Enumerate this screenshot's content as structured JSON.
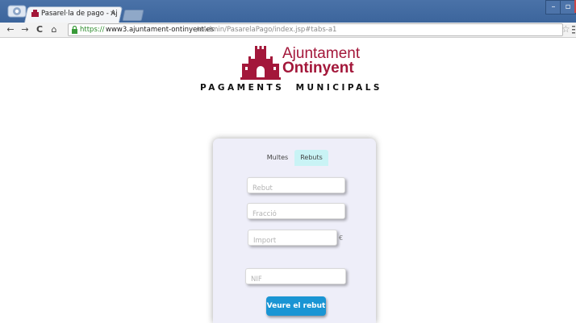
{
  "browser": {
    "tab_title": "Pasarel·la de pago - Aj",
    "tab_close": "×",
    "url_secure": "https://",
    "url_domain": "www3.ajuntament-ontinyent.es",
    "url_path": "/eAdmin/PasarelaPago/index.jsp#tabs-a1",
    "controls": {
      "minimize": "–",
      "maximize": "▫",
      "close": "x"
    },
    "nav": {
      "back": "←",
      "forward": "→",
      "reload": "C",
      "home": "⌂"
    },
    "star": "☆"
  },
  "page": {
    "logo_line1": "Ajuntament",
    "logo_line2": "Ontinyent",
    "heading": "PAGAMENTS  MUNICIPALS",
    "brand_color": "#a3173a",
    "tabs": [
      {
        "label": "Multes",
        "active": false
      },
      {
        "label": "Rebuts",
        "active": true
      }
    ],
    "form": {
      "rebut_placeholder": "Rebut",
      "fraccio_placeholder": "Fracció",
      "import_placeholder": "Import",
      "currency": "€",
      "nif_placeholder": "NIF",
      "submit_label": "Veure el rebut",
      "submit_color": "#1a95d4"
    }
  }
}
